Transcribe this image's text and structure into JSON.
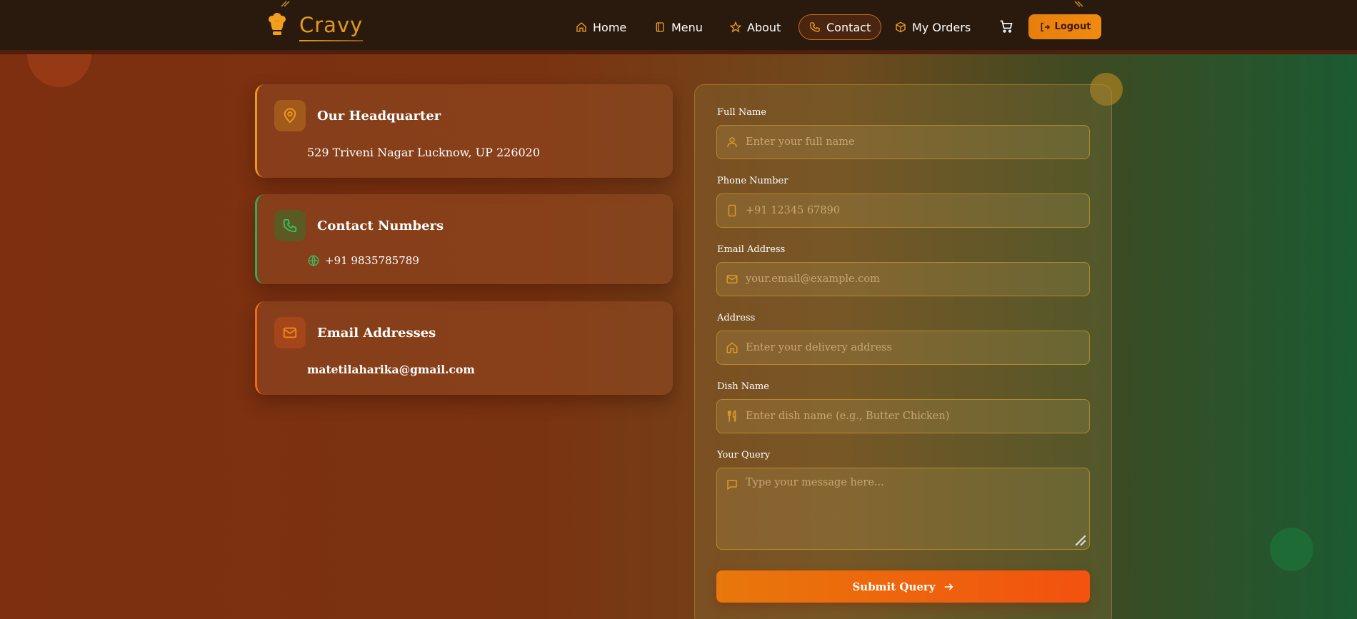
{
  "brand": {
    "name": "Cravy",
    "accent": "#e39a1b"
  },
  "nav": {
    "items": [
      {
        "label": "Home",
        "icon": "home-icon"
      },
      {
        "label": "Menu",
        "icon": "book-icon"
      },
      {
        "label": "About",
        "icon": "star-icon"
      },
      {
        "label": "Contact",
        "icon": "phone-icon",
        "active": true
      },
      {
        "label": "My Orders",
        "icon": "package-icon"
      }
    ],
    "cart_icon": "cart-icon",
    "logout_label": "Logout"
  },
  "info": {
    "headquarter": {
      "title": "Our Headquarter",
      "text": "529 Triveni Nagar Lucknow, UP 226020",
      "color": "#f09a18"
    },
    "contact": {
      "title": "Contact Numbers",
      "text": "+91 9835785789",
      "color": "#2fae55"
    },
    "email": {
      "title": "Email Addresses",
      "text": "matetilaharika@gmail.com",
      "color": "#f06a1a"
    }
  },
  "form": {
    "full_name": {
      "label": "Full Name",
      "placeholder": "Enter your full name"
    },
    "phone": {
      "label": "Phone Number",
      "placeholder": "+91 12345 67890"
    },
    "email": {
      "label": "Email Address",
      "placeholder": "your.email@example.com"
    },
    "address": {
      "label": "Address",
      "placeholder": "Enter your delivery address"
    },
    "dish": {
      "label": "Dish Name",
      "placeholder": "Enter dish name (e.g., Butter Chicken)"
    },
    "query": {
      "label": "Your Query",
      "placeholder": "Type your message here..."
    },
    "submit_label": "Submit Query"
  }
}
